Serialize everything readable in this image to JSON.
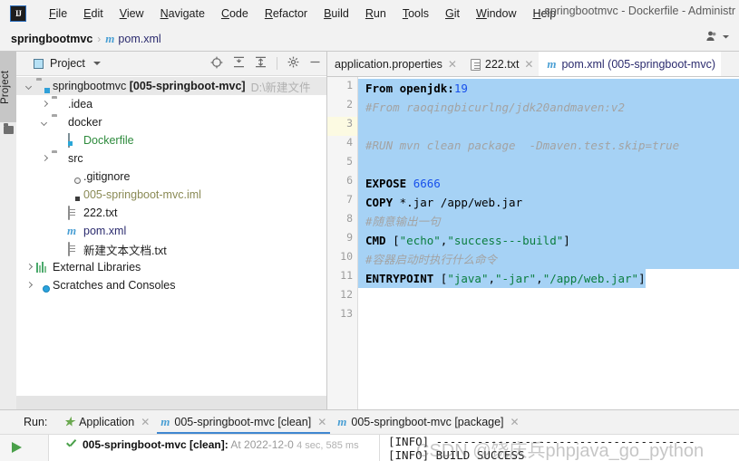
{
  "window": {
    "title": "springbootmvc - Dockerfile - Administr",
    "logo_text": "IJ"
  },
  "menu": {
    "items": [
      {
        "label": "File",
        "mnemonic": "F"
      },
      {
        "label": "Edit",
        "mnemonic": "E"
      },
      {
        "label": "View",
        "mnemonic": "V"
      },
      {
        "label": "Navigate",
        "mnemonic": "N"
      },
      {
        "label": "Code",
        "mnemonic": "C"
      },
      {
        "label": "Refactor",
        "mnemonic": "R"
      },
      {
        "label": "Build",
        "mnemonic": "B"
      },
      {
        "label": "Run",
        "mnemonic": "R"
      },
      {
        "label": "Tools",
        "mnemonic": "T"
      },
      {
        "label": "Git",
        "mnemonic": "G"
      },
      {
        "label": "Window",
        "mnemonic": "W"
      },
      {
        "label": "Help",
        "mnemonic": "H"
      }
    ]
  },
  "navbar": {
    "project_crumb": "springbootmvc",
    "separator": "›",
    "file_crumb": "pom.xml",
    "maven_glyph": "m",
    "account_icon": "user-icon"
  },
  "tool_stripe": {
    "label": "Project",
    "folder_icon": "folder-icon"
  },
  "project_panel": {
    "header": {
      "title": "Project",
      "dropdown_icon": "chevron-down-icon",
      "tools": [
        {
          "name": "locate-icon"
        },
        {
          "name": "expand-all-icon"
        },
        {
          "name": "collapse-all-icon"
        },
        {
          "name": "settings-gear-icon"
        },
        {
          "name": "hide-panel-icon"
        }
      ]
    },
    "tree": [
      {
        "indent": 0,
        "arrow": "down",
        "icon": "module-folder-icon",
        "label": "springbootmvc",
        "bold_suffix": "[005-springboot-mvc]",
        "path": "D:\\新建文件",
        "selected": true
      },
      {
        "indent": 1,
        "arrow": "right",
        "icon": "folder-icon",
        "label": ".idea"
      },
      {
        "indent": 1,
        "arrow": "down",
        "icon": "folder-icon",
        "label": "docker"
      },
      {
        "indent": 2,
        "arrow": "none",
        "icon": "dockerfile-icon",
        "label": "Dockerfile",
        "color": "green"
      },
      {
        "indent": 1,
        "arrow": "right",
        "icon": "folder-icon",
        "label": "src"
      },
      {
        "indent": 2,
        "arrow": "none",
        "icon": "gitignore-icon",
        "label": ".gitignore"
      },
      {
        "indent": 2,
        "arrow": "none",
        "icon": "iml-icon",
        "label": "005-springboot-mvc.iml",
        "color": "tan"
      },
      {
        "indent": 2,
        "arrow": "none",
        "icon": "text-file-icon",
        "label": "222.txt"
      },
      {
        "indent": 2,
        "arrow": "none",
        "icon": "maven-icon",
        "label": "pom.xml",
        "color": "blue"
      },
      {
        "indent": 2,
        "arrow": "none",
        "icon": "text-file-icon",
        "label": "新建文本文档.txt"
      },
      {
        "indent": 0,
        "arrow": "right",
        "icon": "libraries-icon",
        "label": "External Libraries"
      },
      {
        "indent": 0,
        "arrow": "right",
        "icon": "scratches-icon",
        "label": "Scratches and Consoles"
      }
    ]
  },
  "editor": {
    "tabs": [
      {
        "label": "application.properties",
        "icon": "properties-file-icon",
        "active": false,
        "closable": true
      },
      {
        "label": "222.txt",
        "icon": "text-file-icon",
        "active": false,
        "closable": true
      },
      {
        "label": "pom.xml (005-springboot-mvc)",
        "icon": "maven-icon",
        "active": true,
        "closable": false
      }
    ],
    "current_line": 3,
    "selection_from_line": 1,
    "selection_to_line": 11,
    "lines": [
      {
        "n": 1,
        "tokens": [
          {
            "t": "From openjdk:",
            "c": "kw"
          },
          {
            "t": "19",
            "c": "num"
          }
        ],
        "selected": true
      },
      {
        "n": 2,
        "tokens": [
          {
            "t": "#From raoqingbicurlng/jdk20andmaven:v2",
            "c": "cmt"
          }
        ],
        "selected": true
      },
      {
        "n": 3,
        "tokens": [],
        "selected": true
      },
      {
        "n": 4,
        "tokens": [
          {
            "t": "#RUN mvn clean package  -Dmaven.test.skip=true",
            "c": "cmt"
          }
        ],
        "selected": true
      },
      {
        "n": 5,
        "tokens": [],
        "selected": true
      },
      {
        "n": 6,
        "tokens": [
          {
            "t": "EXPOSE ",
            "c": "kw"
          },
          {
            "t": "6666",
            "c": "num"
          }
        ],
        "selected": true
      },
      {
        "n": 7,
        "tokens": [
          {
            "t": "COPY ",
            "c": "kw"
          },
          {
            "t": "*.jar /app/web.jar",
            "c": "plain"
          }
        ],
        "selected": true
      },
      {
        "n": 8,
        "tokens": [
          {
            "t": "#随意输出一句",
            "c": "cmt"
          }
        ],
        "selected": true
      },
      {
        "n": 9,
        "tokens": [
          {
            "t": "CMD ",
            "c": "kw"
          },
          {
            "t": "[",
            "c": "plain"
          },
          {
            "t": "\"echo\"",
            "c": "str"
          },
          {
            "t": ",",
            "c": "plain"
          },
          {
            "t": "\"success---build\"",
            "c": "str"
          },
          {
            "t": "]",
            "c": "plain"
          }
        ],
        "selected": true
      },
      {
        "n": 10,
        "tokens": [
          {
            "t": "#容器启动时执行什么命令",
            "c": "cmt"
          }
        ],
        "selected": true
      },
      {
        "n": 11,
        "tokens": [
          {
            "t": "ENTRYPOINT ",
            "c": "kw"
          },
          {
            "t": "[",
            "c": "plain"
          },
          {
            "t": "\"java\"",
            "c": "str"
          },
          {
            "t": ",",
            "c": "plain"
          },
          {
            "t": "\"-jar\"",
            "c": "str"
          },
          {
            "t": ",",
            "c": "plain"
          },
          {
            "t": "\"/app/web.jar\"",
            "c": "str"
          },
          {
            "t": "]",
            "c": "plain"
          }
        ],
        "selected": "partial"
      },
      {
        "n": 12,
        "tokens": [],
        "selected": false
      },
      {
        "n": 13,
        "tokens": [],
        "selected": false
      }
    ]
  },
  "run_panel": {
    "label": "Run:",
    "tabs": [
      {
        "label": "Application",
        "icon": "spring-app-icon",
        "active": false,
        "closable": true
      },
      {
        "label": "005-springboot-mvc [clean]",
        "icon": "maven-icon",
        "active": true,
        "closable": true
      },
      {
        "label": "005-springboot-mvc [package]",
        "icon": "maven-icon",
        "active": false,
        "closable": true
      }
    ],
    "rerun_icon": "run-play-icon",
    "result": {
      "status_icon": "success-check-icon",
      "name": "005-springboot-mvc [clean]:",
      "timestamp": "At 2022-12-0",
      "duration": "4 sec, 585 ms"
    },
    "console": {
      "lines": [
        "[INFO] --------------------------------------",
        "[INFO] BUILD SUCCESS"
      ],
      "watermark": "CSDN @饶庆兵phpjava_go_python"
    }
  },
  "colors": {
    "accent": "#3f87d0",
    "selection": "#a6d2f5",
    "keyword": "#000000",
    "comment": "#a3a3a3",
    "string": "#0a7d3e",
    "number": "#1750eb",
    "success": "#4aa04a"
  }
}
